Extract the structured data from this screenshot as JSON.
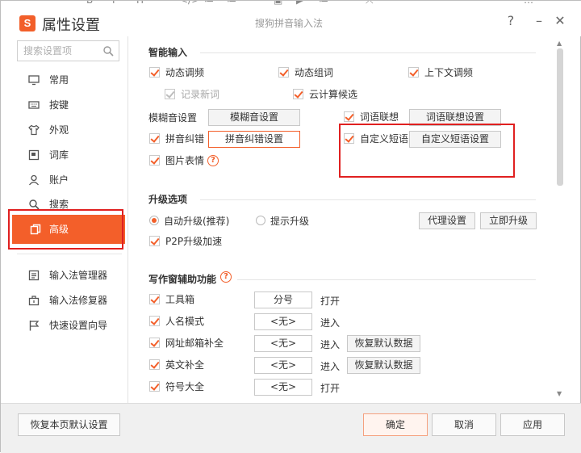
{
  "app": {
    "logo_letter": "S",
    "title": "属性设置",
    "subtitle": "搜狗拼音输入法",
    "help_label": "?",
    "minimize_label": "–",
    "close_label": "✕"
  },
  "top_strip": [
    "B",
    "I",
    "H",
    "❝",
    "</>",
    "≔",
    "≔",
    "▣",
    "▶",
    "≔",
    "⤫",
    "…"
  ],
  "sidebar": {
    "search_placeholder": "搜索设置项",
    "items": [
      {
        "label": "常用",
        "icon": "monitor-icon"
      },
      {
        "label": "按键",
        "icon": "keyboard-icon"
      },
      {
        "label": "外观",
        "icon": "shirt-icon"
      },
      {
        "label": "词库",
        "icon": "book-icon"
      },
      {
        "label": "账户",
        "icon": "user-icon"
      },
      {
        "label": "搜索",
        "icon": "search-icon"
      },
      {
        "label": "高级",
        "icon": "layers-icon",
        "active": true
      },
      {
        "label": "输入法管理器",
        "icon": "manager-icon"
      },
      {
        "label": "输入法修复器",
        "icon": "toolbox-icon"
      },
      {
        "label": "快速设置向导",
        "icon": "flag-icon"
      }
    ]
  },
  "smart_input": {
    "title": "智能输入",
    "dynamic_freq": "动态调频",
    "dynamic_words": "动态组词",
    "context_freq": "上下文调频",
    "record_new_words": "记录新词",
    "cloud_candidates": "云计算候选",
    "fuzzy_label": "模糊音设置",
    "fuzzy_button": "模糊音设置",
    "word_assoc": "词语联想",
    "word_assoc_button": "词语联想设置",
    "pinyin_correct": "拼音纠错",
    "pinyin_correct_button": "拼音纠错设置",
    "custom_phrase": "自定义短语",
    "custom_phrase_button": "自定义短语设置",
    "emoji": "图片表情"
  },
  "upgrade": {
    "title": "升级选项",
    "auto_upgrade": "自动升级(推荐)",
    "prompt_upgrade": "提示升级",
    "proxy_button": "代理设置",
    "upgrade_now_button": "立即升级",
    "p2p": "P2P升级加速"
  },
  "writing": {
    "title": "写作窗辅助功能",
    "rows": [
      {
        "label": "工具箱",
        "value": "分号",
        "action": "打开",
        "restore": ""
      },
      {
        "label": "人名模式",
        "value": "<无>",
        "action": "进入",
        "restore": ""
      },
      {
        "label": "网址邮箱补全",
        "value": "<无>",
        "action": "进入",
        "restore": "恢复默认数据"
      },
      {
        "label": "英文补全",
        "value": "<无>",
        "action": "进入",
        "restore": "恢复默认数据"
      },
      {
        "label": "符号大全",
        "value": "<无>",
        "action": "打开",
        "restore": ""
      }
    ]
  },
  "footer": {
    "restore_defaults": "恢复本页默认设置",
    "ok": "确定",
    "cancel": "取消",
    "apply": "应用"
  },
  "colors": {
    "accent": "#f35f2a",
    "highlight_frame": "#e02020"
  }
}
